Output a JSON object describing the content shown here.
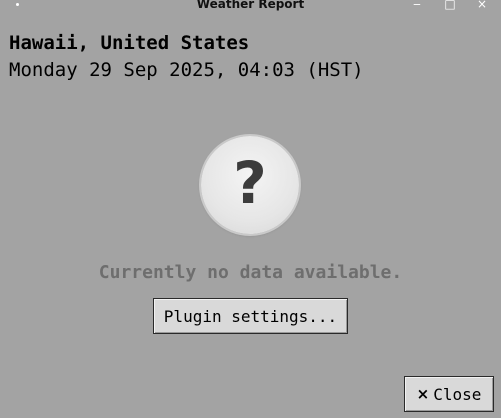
{
  "window": {
    "title": "Weather Report",
    "controls": {
      "minimize": "‒",
      "maximize": "□",
      "close": "×"
    }
  },
  "header": {
    "location": "Hawaii, United States",
    "datetime": "Monday 29 Sep 2025, 04:03 (HST)"
  },
  "status": {
    "icon_glyph": "?",
    "message": "Currently no data available."
  },
  "buttons": {
    "plugin_settings": "Plugin settings...",
    "close_icon": "×",
    "close_label": "Close"
  },
  "colors": {
    "background": "#a3a3a3",
    "button": "#d9d9d9",
    "muted_text": "#6e6e6e"
  }
}
